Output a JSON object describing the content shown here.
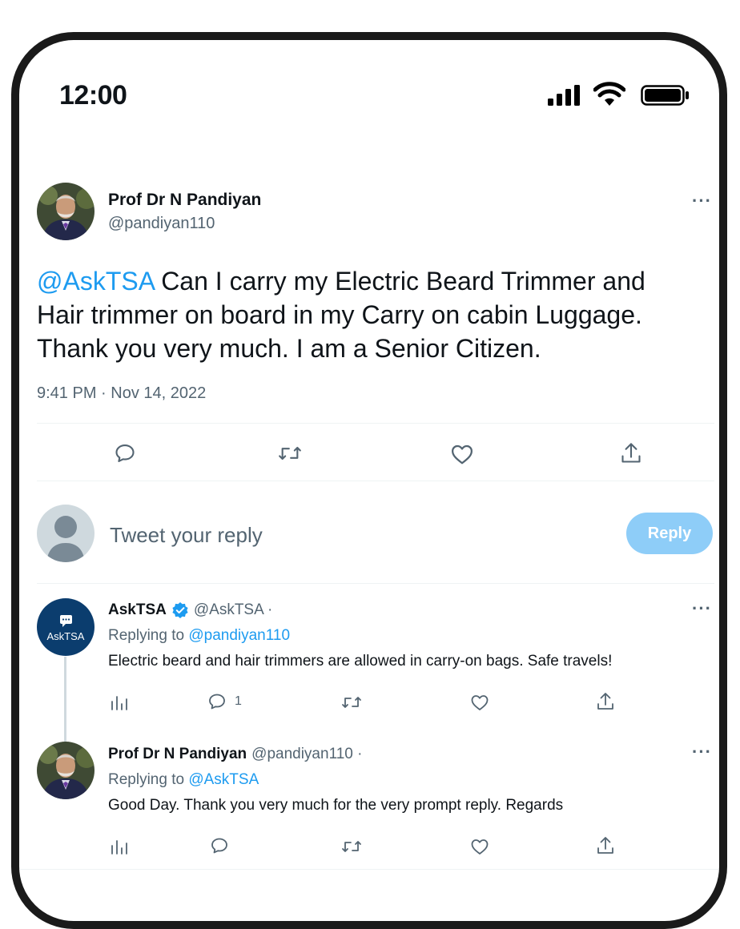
{
  "status_bar": {
    "time": "12:00"
  },
  "main_tweet": {
    "author_name": "Prof Dr N Pandiyan",
    "author_handle": "@pandiyan110",
    "mention": "@AskTSA",
    "text": " Can I carry my Electric Beard Trimmer and Hair trimmer on board in my Carry on cabin Luggage. Thank you very much. I am a Senior Citizen.",
    "timestamp": "9:41 PM · Nov 14, 2022",
    "more_label": "···"
  },
  "compose": {
    "placeholder": "Tweet your reply",
    "reply_button": "Reply"
  },
  "replies": [
    {
      "author_name": "AskTSA",
      "author_handle": "@AskTSA ·",
      "verified": true,
      "avatar_text": "AskTSA",
      "replying_to_prefix": "Replying to ",
      "replying_to": "@pandiyan110",
      "text": "Electric beard and hair trimmers are allowed in carry-on bags. Safe travels!",
      "reply_count": "1",
      "more_label": "···"
    },
    {
      "author_name": "Prof Dr N Pandiyan",
      "author_handle": "@pandiyan110 ·",
      "verified": false,
      "replying_to_prefix": "Replying to ",
      "replying_to": "@AskTSA",
      "text": "Good Day. Thank you very much for the very prompt reply. Regards",
      "reply_count": "",
      "more_label": "···"
    }
  ],
  "colors": {
    "accent": "#1d9bf0",
    "secondary_text": "#536471",
    "reply_button_disabled": "#8ecdf8",
    "tsa_avatar": "#0b3d6e"
  },
  "icons": [
    "reply-icon",
    "retweet-icon",
    "like-icon",
    "share-icon",
    "analytics-icon",
    "verified-badge-icon"
  ]
}
